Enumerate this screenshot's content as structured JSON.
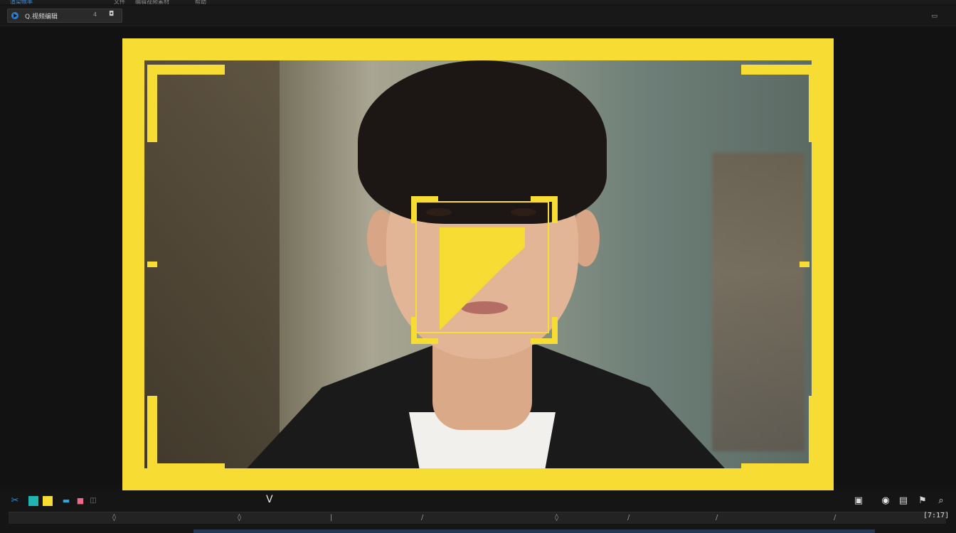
{
  "app": {
    "menu_items": [
      "渲染帧率",
      "文件",
      "编辑视频素材",
      "帮助"
    ],
    "tab_title": "Q.视频编辑",
    "tab_extra": "4",
    "tab_close_glyph": "◘",
    "window_control": "▭"
  },
  "viewer": {
    "overlay_color": "#f6dc33",
    "subject": "portrait-face-detection"
  },
  "bottom": {
    "left_icons": [
      "scissors-icon",
      "clip-icon",
      "color-swatch-icon",
      "camera-icon",
      "marker-icon",
      "badge-icon"
    ],
    "current_marker": "V",
    "right_icons": [
      "export-icon",
      "snapshot-icon",
      "grid-icon",
      "flag-icon",
      "zoom-icon"
    ],
    "ruler_marks": [
      "◊",
      "◊",
      "|",
      "/",
      "◊",
      "/",
      "/",
      "/"
    ],
    "end_time": "[7:17]"
  }
}
